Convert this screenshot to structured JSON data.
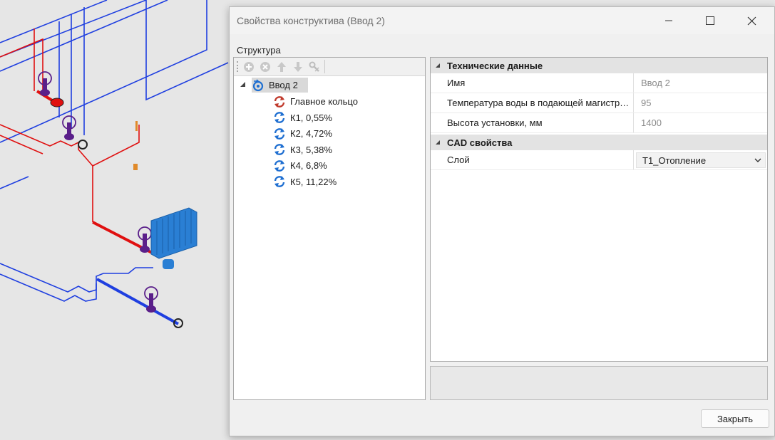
{
  "window": {
    "title": "Свойства конструктива (Ввод 2)"
  },
  "structure": {
    "label": "Структура",
    "root": {
      "label": "Ввод 2"
    },
    "items": [
      {
        "label": "Главное кольцо",
        "icon": "main-ring-icon",
        "color": "#c0392b"
      },
      {
        "label": "К1, 0,55%",
        "icon": "ring-icon",
        "color": "#1f6fd1"
      },
      {
        "label": "К2, 4,72%",
        "icon": "ring-icon",
        "color": "#1f6fd1"
      },
      {
        "label": "К3, 5,38%",
        "icon": "ring-icon",
        "color": "#1f6fd1"
      },
      {
        "label": "К4, 6,8%",
        "icon": "ring-icon",
        "color": "#1f6fd1"
      },
      {
        "label": "К5, 11,22%",
        "icon": "ring-icon",
        "color": "#1f6fd1"
      }
    ]
  },
  "properties": {
    "tech": {
      "title": "Технические данные",
      "name_label": "Имя",
      "name_value": "Ввод 2",
      "temp_label": "Температура воды в подающей магистрали, °C",
      "temp_value": "95",
      "height_label": "Высота установки, мм",
      "height_value": "1400"
    },
    "cad": {
      "title": "CAD свойства",
      "layer_label": "Слой",
      "layer_value": "Т1_Отопление"
    }
  },
  "buttons": {
    "close": "Закрыть"
  },
  "colors": {
    "supply_pipe": "#e01010",
    "return_pipe": "#1f3fe0",
    "valve": "#5a1f8a",
    "radiator": "#2a7fd4"
  }
}
